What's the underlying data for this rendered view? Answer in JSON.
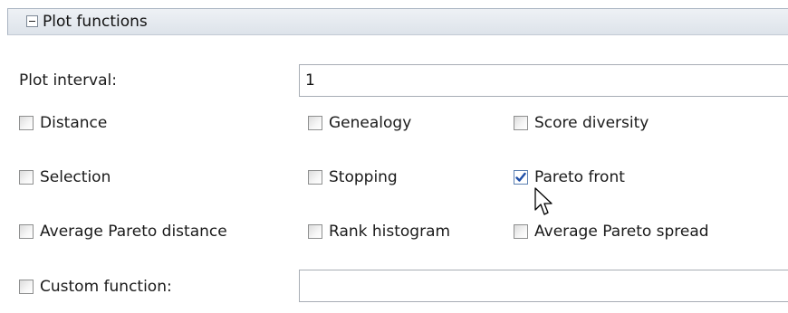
{
  "section": {
    "title": "Plot functions",
    "collapse_icon": "minus-box-icon"
  },
  "plot_interval": {
    "label": "Plot interval:",
    "value": "1"
  },
  "checkboxes": {
    "distance": {
      "label": "Distance",
      "checked": false
    },
    "genealogy": {
      "label": "Genealogy",
      "checked": false
    },
    "score_diversity": {
      "label": "Score diversity",
      "checked": false
    },
    "selection": {
      "label": "Selection",
      "checked": false
    },
    "stopping": {
      "label": "Stopping",
      "checked": false
    },
    "pareto_front": {
      "label": "Pareto front",
      "checked": true
    },
    "average_pareto_distance": {
      "label": "Average Pareto distance",
      "checked": false
    },
    "rank_histogram": {
      "label": "Rank histogram",
      "checked": false
    },
    "average_pareto_spread": {
      "label": "Average Pareto spread",
      "checked": false
    },
    "custom_function": {
      "label": "Custom function:",
      "checked": false
    }
  },
  "custom_function_field": {
    "value": ""
  },
  "colors": {
    "check_mark": "#1f4fa8",
    "header_border": "#a9b4c2"
  }
}
